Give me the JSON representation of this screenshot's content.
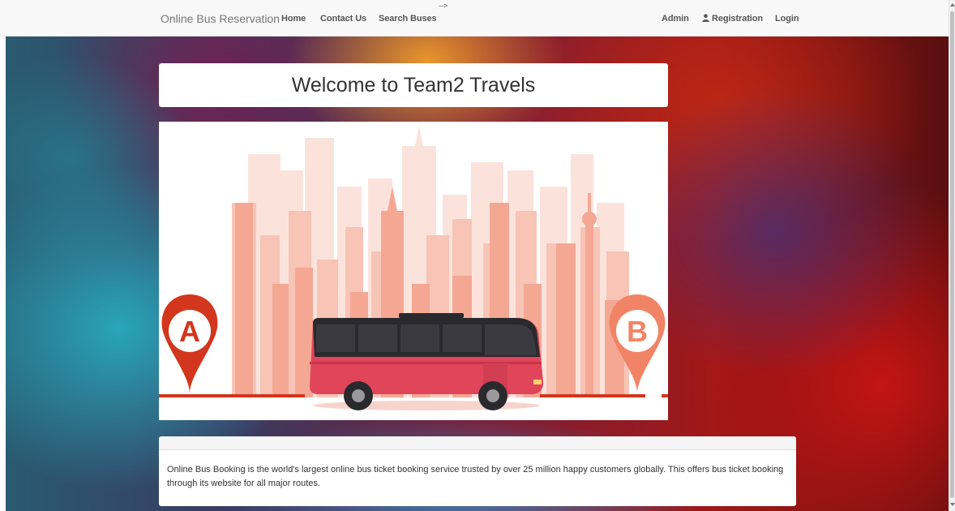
{
  "navbar": {
    "brand": "Online Bus Reservation",
    "home": "Home",
    "contact": "Contact Us",
    "search": "Search Buses",
    "stray": "-->",
    "admin": "Admin",
    "registration": "Registration",
    "login": "Login"
  },
  "welcome": {
    "title": "Welcome to Team2 Travels"
  },
  "hero": {
    "marker_a": "A",
    "marker_b": "B"
  },
  "info": {
    "text": "Online Bus Booking is the world's largest online bus ticket booking service trusted by over 25 million happy customers globally. This offers bus ticket booking through its website for all major routes."
  },
  "colors": {
    "navbar_bg": "#f8f8f8",
    "skyline_light": "#f9d7cf",
    "skyline_mid": "#f4a894",
    "marker_a": "#d2361d",
    "marker_b": "#f18466",
    "bus_body": "#e0455a"
  }
}
